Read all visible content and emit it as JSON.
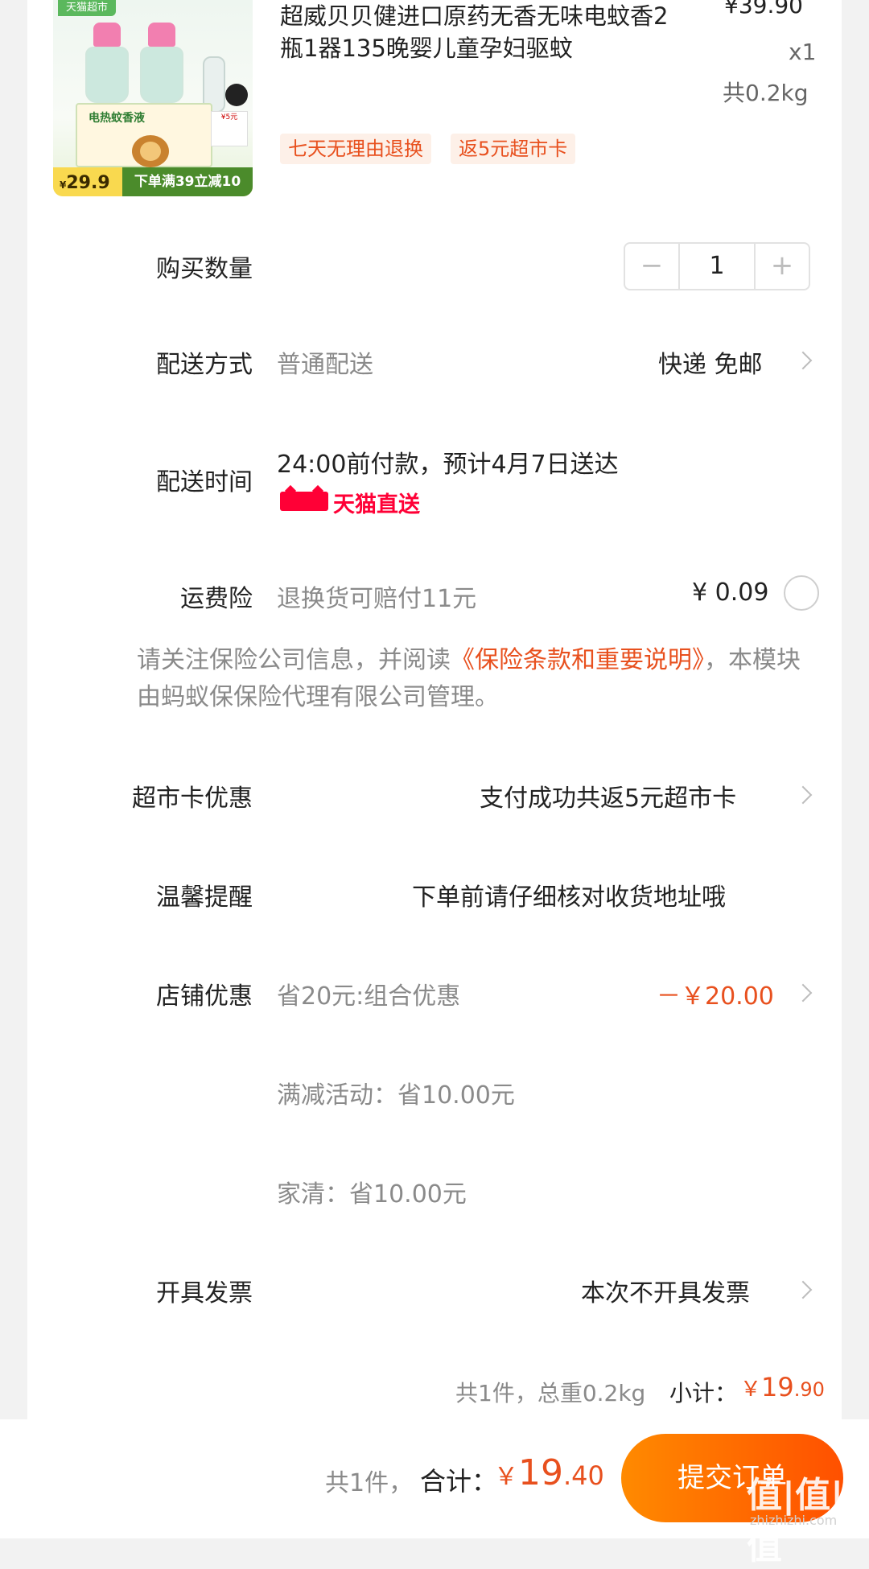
{
  "product": {
    "image_tag": "天猫超市",
    "image_box_text": "电热蚊香液",
    "image_promo_price": "29.9",
    "image_promo_currency": "¥",
    "image_promo_text": "下单满39立减10",
    "image_card_text": "¥5元",
    "title": "超威贝贝健进口原药无香无味电蚊香2瓶1器135晚婴儿童孕妇驱蚊",
    "price": "¥39.90",
    "quantity": "x1",
    "weight": "共0.2kg",
    "tags": [
      "七天无理由退换",
      "返5元超市卡"
    ]
  },
  "quantity_row": {
    "label": "购买数量",
    "value": "1",
    "minus": "−",
    "plus": "+"
  },
  "delivery_method": {
    "label": "配送方式",
    "value": "普通配送",
    "option": "快递 免邮"
  },
  "delivery_time": {
    "label": "配送时间",
    "value": "24:00前付款，预计4月7日送达",
    "badge": "天猫直送"
  },
  "shipping_insurance": {
    "label": "运费险",
    "value": "退换货可赔付11元",
    "price": "¥ 0.09"
  },
  "insurance_notice": {
    "prefix": "请关注保险公司信息，并阅读",
    "link": "《保险条款和重要说明》",
    "suffix": "，本模块由蚂蚁保保险代理有限公司管理。"
  },
  "supermarket_card": {
    "label": "超市卡优惠",
    "value": "支付成功共返5元超市卡"
  },
  "reminder": {
    "label": "温馨提醒",
    "value": "下单前请仔细核对收货地址哦"
  },
  "store_discount": {
    "label": "店铺优惠",
    "value": "省20元:组合优惠",
    "amount": "－￥20.00",
    "details": [
      "满减活动：省10.00元",
      "家清：省10.00元"
    ]
  },
  "invoice": {
    "label": "开具发票",
    "value": "本次不开具发票"
  },
  "summary": {
    "text": "共1件，总重0.2kg",
    "subtotal_label": "小计：",
    "subtotal_currency": "￥",
    "subtotal_int": "19",
    "subtotal_dec": ".90"
  },
  "footer": {
    "count": "共1件，",
    "total_label": "合计：",
    "currency": "￥",
    "total_int": "19",
    "total_dec": ".40",
    "submit": "提交订单"
  },
  "watermark": {
    "main": "值|值|值",
    "sub": "zhizhizhi.com"
  },
  "colors": {
    "accent": "#e8501e",
    "tmall_red": "#ff0036",
    "button_gradient_start": "#ff8a00",
    "button_gradient_end": "#ff5000"
  }
}
